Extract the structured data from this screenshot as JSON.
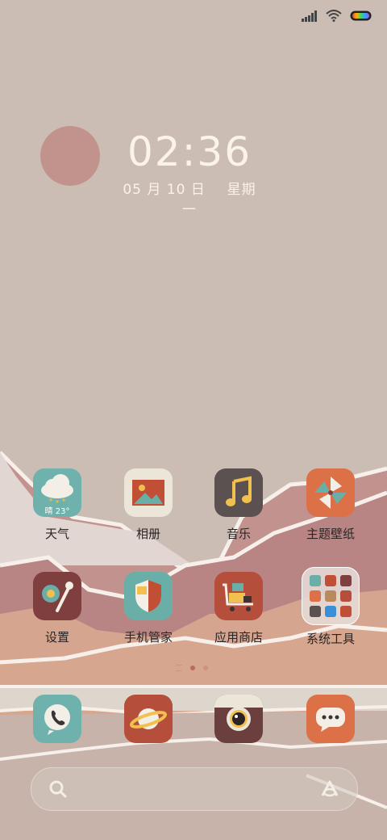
{
  "status_bar": {
    "signal_icon": "signal-bars-icon",
    "wifi_icon": "wifi-icon",
    "battery_icon": "rainbow-battery-icon"
  },
  "clock": {
    "time": "02:36",
    "date": "05 月 10 日",
    "weekday": "星期一"
  },
  "apps_row1": [
    {
      "label": "天气",
      "icon": "weather-cloud-icon",
      "overlay": "晴 23°",
      "bg": "#6fb2ad"
    },
    {
      "label": "相册",
      "icon": "gallery-icon",
      "bg": "#ece6d9"
    },
    {
      "label": "音乐",
      "icon": "music-note-icon",
      "bg": "#5b5151"
    },
    {
      "label": "主题壁纸",
      "icon": "pinwheel-icon",
      "bg": "#dc7046"
    }
  ],
  "apps_row2": [
    {
      "label": "设置",
      "icon": "gear-wrench-icon",
      "bg": "#7f3f3e"
    },
    {
      "label": "手机管家",
      "icon": "shield-icon",
      "bg": "#6aaea8"
    },
    {
      "label": "应用商店",
      "icon": "shop-cart-icon",
      "bg": "#b54f3b"
    },
    {
      "label": "系统工具",
      "icon": "folder-grid-icon",
      "bg": "#ddd2cc"
    }
  ],
  "dock": [
    {
      "name": "phone",
      "icon": "phone-icon",
      "bg": "#6fb2ad"
    },
    {
      "name": "browser",
      "icon": "planet-icon",
      "bg": "#b54f3b"
    },
    {
      "name": "camera",
      "icon": "camera-icon",
      "bg": "#6b3f3e"
    },
    {
      "name": "messages",
      "icon": "chat-bubble-icon",
      "bg": "#dc7046"
    }
  ],
  "search": {
    "search_icon": "search-icon",
    "assistant_icon": "assistant-a-icon"
  },
  "colors": {
    "background": "#cbbcb4",
    "accent_orange": "#dc7046",
    "teal": "#6fb2ad",
    "sun": "#c1938c"
  }
}
